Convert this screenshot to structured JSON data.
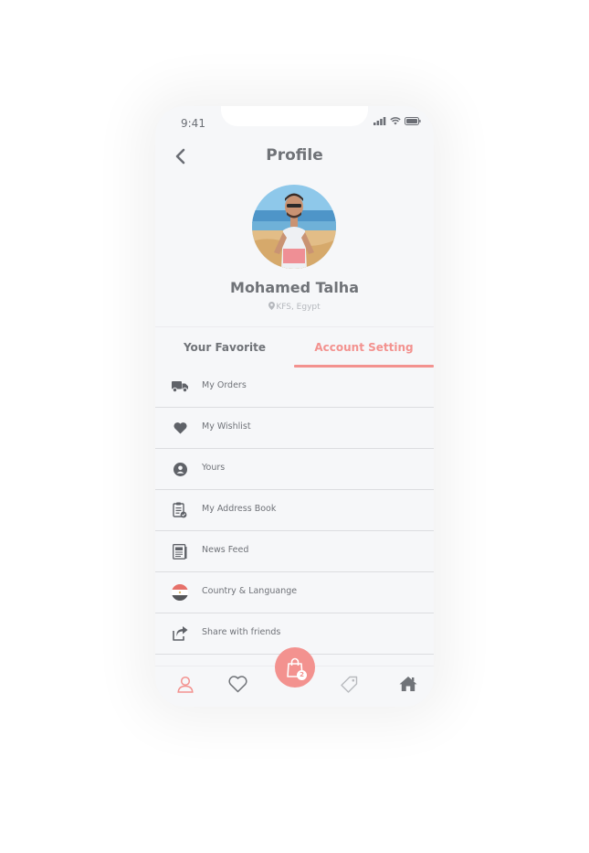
{
  "status_bar": {
    "time": "9:41"
  },
  "header": {
    "title": "Profile"
  },
  "profile": {
    "name": "Mohamed Talha",
    "location": "KFS, Egypt"
  },
  "tabs": [
    {
      "label": "Your Favorite",
      "active": false
    },
    {
      "label": "Account Setting",
      "active": true
    }
  ],
  "menu": [
    {
      "label": "My Orders",
      "icon": "truck-icon"
    },
    {
      "label": "My Wishlist",
      "icon": "heart-icon"
    },
    {
      "label": "Yours",
      "icon": "user-circle-icon"
    },
    {
      "label": "My Address Book",
      "icon": "clipboard-check-icon"
    },
    {
      "label": "News Feed",
      "icon": "newspaper-icon"
    },
    {
      "label": "Country & Languange",
      "icon": "egypt-flag-icon"
    },
    {
      "label": "Share with friends",
      "icon": "share-icon"
    }
  ],
  "bottom_nav": {
    "items": [
      "profile-icon",
      "heart-outline-icon",
      "shopping-bag-icon",
      "tag-icon",
      "home-icon"
    ],
    "cart_count": "2"
  },
  "colors": {
    "accent": "#f3928f",
    "text": "#707378",
    "background": "#f6f7f9"
  }
}
